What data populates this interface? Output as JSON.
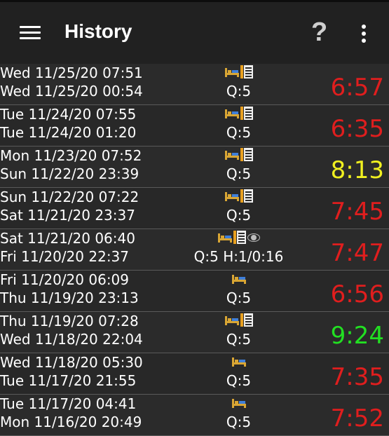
{
  "header": {
    "title": "History",
    "help_label": "?",
    "menu_icon": "hamburger-icon",
    "overflow_icon": "more-vert-icon"
  },
  "colors": {
    "short": "#e01e1e",
    "medium": "#f0f020",
    "long": "#22e022"
  },
  "rows": [
    {
      "end": "Wed 11/25/20 07:51",
      "start": "Wed 11/25/20 00:54",
      "info": "Q:5",
      "duration": "6:57",
      "color": "#e01e1e",
      "icons": [
        "bed-icon",
        "notes-icon"
      ]
    },
    {
      "end": "Tue 11/24/20 07:55",
      "start": "Tue 11/24/20 01:20",
      "info": "Q:5",
      "duration": "6:35",
      "color": "#e01e1e",
      "icons": [
        "bed-icon",
        "notes-icon"
      ]
    },
    {
      "end": "Mon 11/23/20 07:52",
      "start": "Sun 11/22/20 23:39",
      "info": "Q:5",
      "duration": "8:13",
      "color": "#f0f020",
      "icons": [
        "bed-icon",
        "notes-icon"
      ]
    },
    {
      "end": "Sun 11/22/20 07:22",
      "start": "Sat 11/21/20 23:37",
      "info": "Q:5",
      "duration": "7:45",
      "color": "#e01e1e",
      "icons": [
        "bed-icon",
        "notes-icon"
      ]
    },
    {
      "end": "Sat 11/21/20 06:40",
      "start": "Fri 11/20/20 22:37",
      "info": "Q:5 H:1/0:16",
      "duration": "7:47",
      "color": "#e01e1e",
      "icons": [
        "bed-icon",
        "notes-icon",
        "eye-icon"
      ]
    },
    {
      "end": "Fri 11/20/20 06:09",
      "start": "Thu 11/19/20 23:13",
      "info": "Q:5",
      "duration": "6:56",
      "color": "#e01e1e",
      "icons": [
        "bed-icon"
      ]
    },
    {
      "end": "Thu 11/19/20 07:28",
      "start": "Wed 11/18/20 22:04",
      "info": "Q:5",
      "duration": "9:24",
      "color": "#22e022",
      "icons": [
        "bed-icon",
        "notes-icon"
      ]
    },
    {
      "end": "Wed 11/18/20 05:30",
      "start": "Tue 11/17/20 21:55",
      "info": "Q:5",
      "duration": "7:35",
      "color": "#e01e1e",
      "icons": [
        "bed-icon"
      ]
    },
    {
      "end": "Tue 11/17/20 04:41",
      "start": "Mon 11/16/20 20:49",
      "info": "Q:5",
      "duration": "7:52",
      "color": "#e01e1e",
      "icons": [
        "bed-icon"
      ]
    }
  ]
}
